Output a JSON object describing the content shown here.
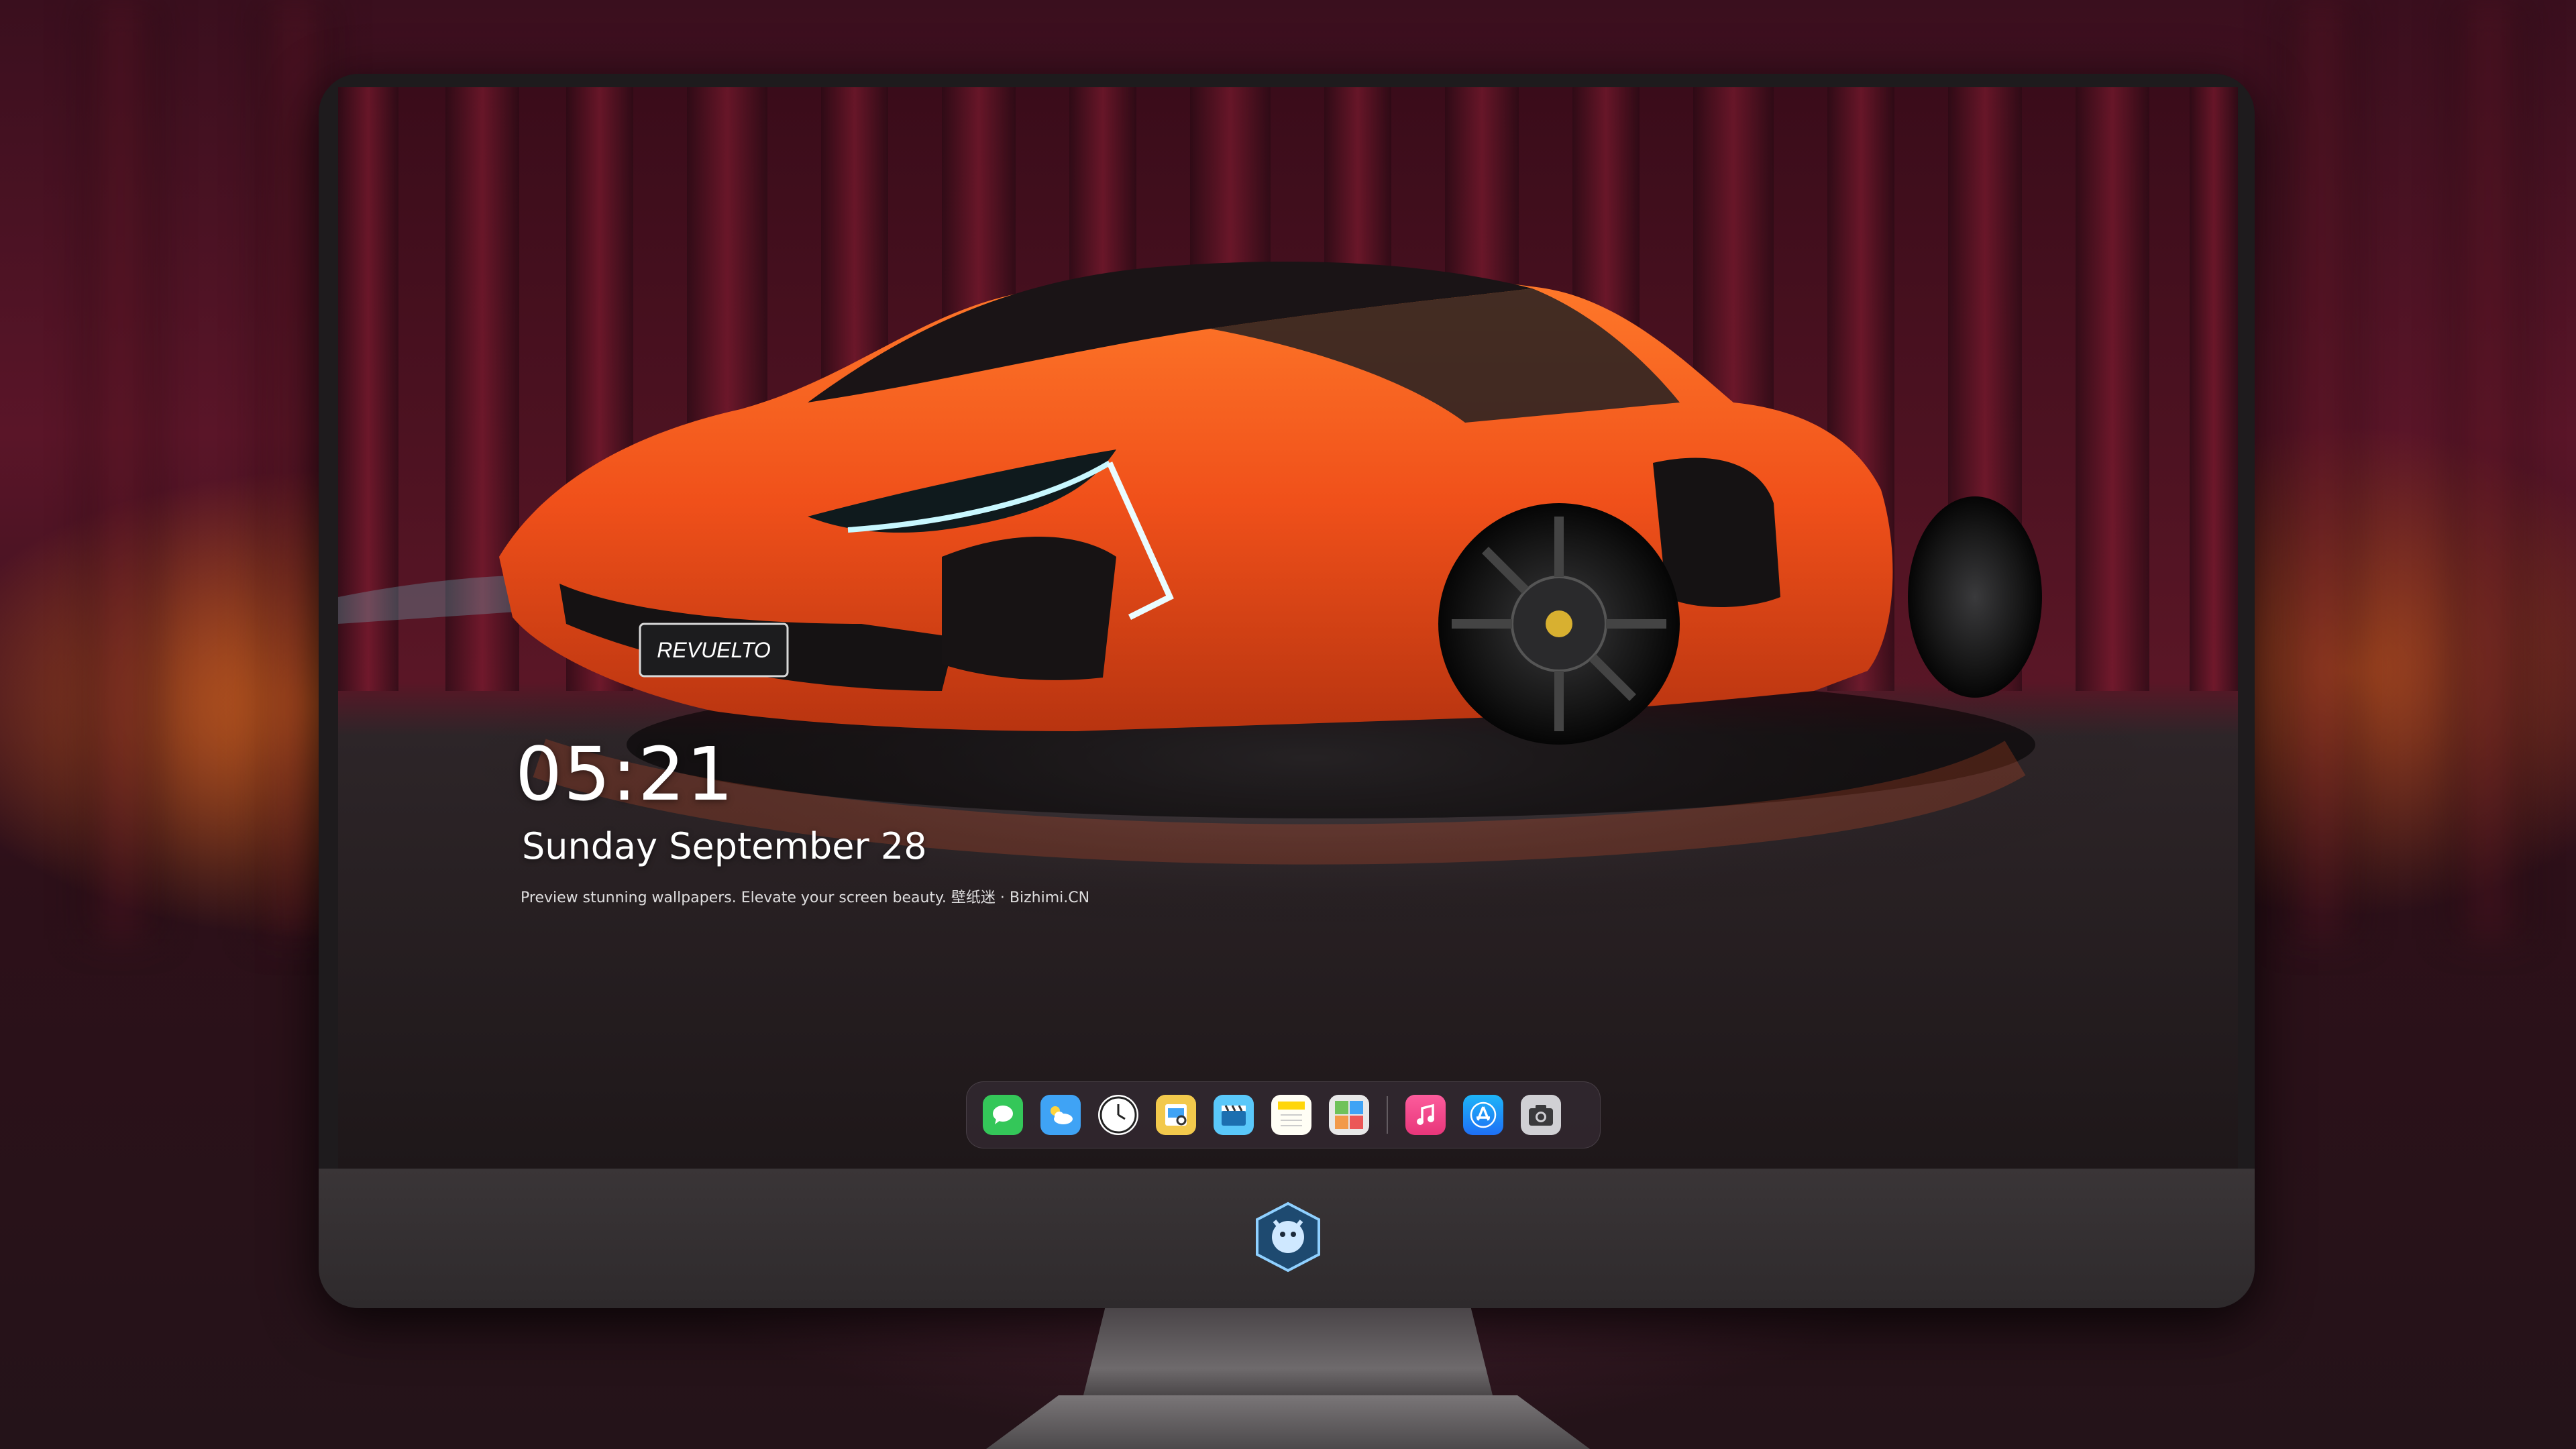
{
  "lock_screen": {
    "time": "05:21",
    "date": "Sunday September  28",
    "tagline": "Preview stunning wallpapers. Elevate your screen beauty. 壁纸迷 · Bizhimi.CN"
  },
  "wallpaper": {
    "plate_text": "REVUELTO",
    "colors": {
      "car_body": "#f0501a",
      "curtain": "#6a1226",
      "floor": "#2a2428"
    }
  },
  "dock": {
    "apps": [
      {
        "icon": "messages-icon",
        "color": "#34c759"
      },
      {
        "icon": "weather-icon",
        "color": "#3fa3f5"
      },
      {
        "icon": "clock-icon",
        "color": "#ffffff"
      },
      {
        "icon": "preview-icon",
        "color": "#f2c94c"
      },
      {
        "icon": "clips-icon",
        "color": "#5ac8fa"
      },
      {
        "icon": "notes-icon",
        "color": "#ffd60a"
      },
      {
        "icon": "photo-booth-icon",
        "color": "#6fc25b"
      },
      {
        "icon": "music-icon",
        "color": "#fc3c8e"
      },
      {
        "icon": "app-store-icon",
        "color": "#1e8ef5"
      },
      {
        "icon": "screenshot-icon",
        "color": "#8e8e93"
      }
    ]
  }
}
